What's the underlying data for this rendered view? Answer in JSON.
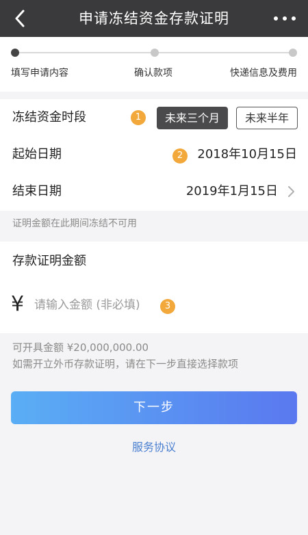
{
  "navbar": {
    "title": "申请冻结资金存款证明",
    "back_icon": "chevron-left-icon",
    "more_icon": "more-dots-icon"
  },
  "steps": [
    {
      "label": "填写申请内容",
      "active": true
    },
    {
      "label": "确认款项",
      "active": false
    },
    {
      "label": "快递信息及费用",
      "active": false
    }
  ],
  "freeze_period": {
    "label": "冻结资金时段",
    "badge": "1",
    "options": [
      {
        "label": "未来三个月",
        "selected": true
      },
      {
        "label": "未来半年",
        "selected": false
      }
    ]
  },
  "start_date": {
    "label": "起始日期",
    "badge": "2",
    "value": "2018年10月15日"
  },
  "end_date": {
    "label": "结束日期",
    "value": "2019年1月15日"
  },
  "period_note": "证明金额在此期间冻结不可用",
  "amount": {
    "title": "存款证明金额",
    "currency_symbol": "¥",
    "placeholder": "请输入金额 (非必填)",
    "value": "",
    "badge": "3"
  },
  "info": {
    "available": "可开具金额 ¥20,000,000.00",
    "foreign_note": "如需开立外币存款证明，请在下一步直接选择款项"
  },
  "next_button": "下一步",
  "agreement_link": "服务协议",
  "colors": {
    "navbar_bg": "#3a3a3c",
    "badge": "#f2a83a",
    "button_start": "#5aaef5",
    "button_end": "#5a78ef",
    "link": "#4a7fd0"
  }
}
